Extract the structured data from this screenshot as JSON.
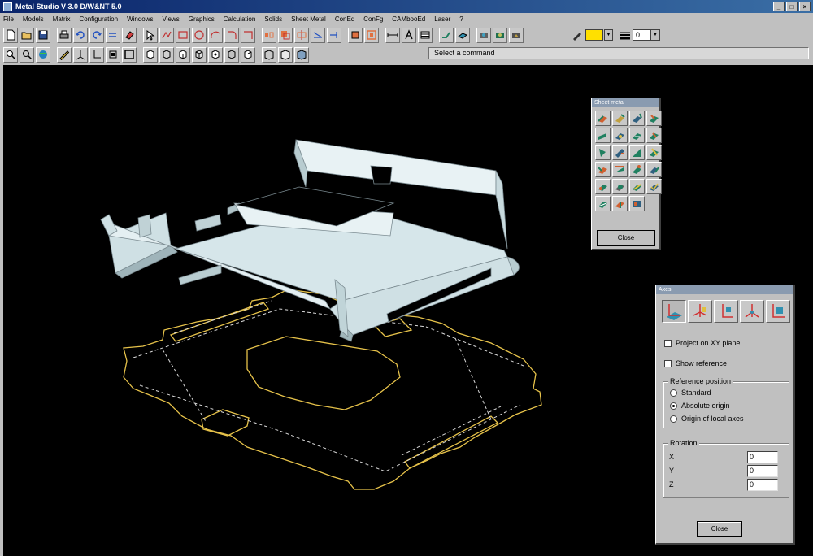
{
  "window": {
    "title": "Metal Studio V  3.0 D/W&NT 5.0",
    "buttons": [
      "_",
      "□",
      "×"
    ]
  },
  "menu": [
    "File",
    "Models",
    "Matrix",
    "Configuration",
    "Windows",
    "Views",
    "Graphics",
    "Calculation",
    "Solids",
    "Sheet Metal",
    "ConEd",
    "ConFg",
    "CAMbooEd",
    "Laser",
    "?"
  ],
  "toolbar": {
    "line_width_value": "0",
    "color_swatch": "#ffe000",
    "status_prompt": "Select a command"
  },
  "palette": {
    "title": "Sheet metal",
    "close_label": "Close"
  },
  "axes_dialog": {
    "title": "Axes",
    "project_xy_label": "Project on XY plane",
    "show_reference_label": "Show reference",
    "reference_group_label": "Reference position",
    "reference_options": [
      "Standard",
      "Absolute origin",
      "Origin of local axes"
    ],
    "reference_selected": "Absolute origin",
    "rotation_group_label": "Rotation",
    "rotation": [
      {
        "axis": "X",
        "value": "0"
      },
      {
        "axis": "Y",
        "value": "0"
      },
      {
        "axis": "Z",
        "value": "0"
      }
    ],
    "close_label": "Close"
  },
  "colors": {
    "viewport_bg": "#000000",
    "solid_face": "#d8e8ec",
    "flat_pattern_line": "#e6c24a"
  }
}
